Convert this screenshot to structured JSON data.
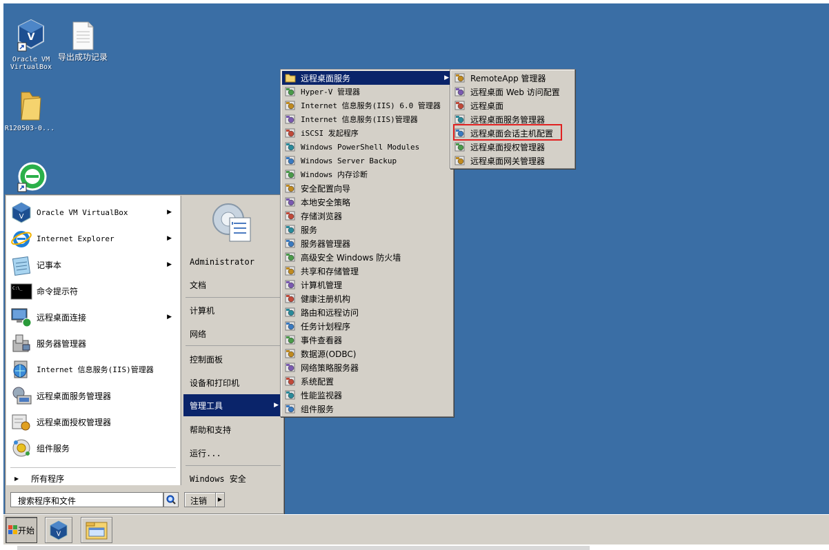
{
  "desktop": {
    "icons": [
      {
        "label": "Oracle VM VirtualBox",
        "label_line1": "Oracle VM",
        "label_line2": "VirtualBox",
        "icon": "virtualbox-icon"
      },
      {
        "label": "导出成功记录",
        "icon": "text-document-icon"
      },
      {
        "label": "R120503-0...",
        "icon": "folder-icon"
      },
      {
        "label": "",
        "icon": "ie-shortcut-icon"
      }
    ]
  },
  "start_menu": {
    "pinned": [
      {
        "label": "Oracle VM VirtualBox",
        "icon": "virtualbox-icon",
        "has_submenu": true,
        "mono": true
      },
      {
        "label": "Internet Explorer",
        "icon": "internet-explorer-icon",
        "has_submenu": true,
        "mono": true
      },
      {
        "label": "记事本",
        "icon": "notepad-icon",
        "has_submenu": true,
        "mono": false
      },
      {
        "label": "命令提示符",
        "icon": "command-prompt-icon",
        "has_submenu": false,
        "mono": false
      },
      {
        "label": "远程桌面连接",
        "icon": "remote-desktop-icon",
        "has_submenu": true,
        "mono": false
      },
      {
        "label": "服务器管理器",
        "icon": "server-manager-icon",
        "has_submenu": false,
        "mono": false
      },
      {
        "label": "Internet 信息服务(IIS)管理器",
        "icon": "iis-manager-icon",
        "has_submenu": false,
        "mono": false
      },
      {
        "label": "远程桌面服务管理器",
        "icon": "rds-manager-icon",
        "has_submenu": false,
        "mono": false
      },
      {
        "label": "远程桌面授权管理器",
        "icon": "rd-licensing-icon",
        "has_submenu": false,
        "mono": false
      },
      {
        "label": "组件服务",
        "icon": "component-services-icon",
        "has_submenu": false,
        "mono": false
      }
    ],
    "all_programs": "所有程序",
    "search_placeholder": "搜索程序和文件",
    "logoff_label": "注销",
    "right_pane": {
      "user": "Administrator",
      "items": [
        {
          "label": "文档"
        },
        {
          "label": "计算机"
        },
        {
          "label": "网络"
        },
        {
          "label": "控制面板"
        },
        {
          "label": "设备和打印机"
        },
        {
          "label": "管理工具",
          "active": true,
          "has_submenu": true
        },
        {
          "label": "帮助和支持"
        },
        {
          "label": "运行..."
        },
        {
          "label": "Windows 安全"
        }
      ]
    }
  },
  "admin_tools_menu": {
    "items": [
      {
        "label": "远程桌面服务",
        "icon": "folder-icon",
        "active": true,
        "has_submenu": true
      },
      {
        "label": "Hyper-V 管理器",
        "icon": "hyperv-icon"
      },
      {
        "label": "Internet 信息服务(IIS) 6.0 管理器",
        "icon": "iis6-icon"
      },
      {
        "label": "Internet 信息服务(IIS)管理器",
        "icon": "iis-manager-icon"
      },
      {
        "label": "iSCSI 发起程序",
        "icon": "iscsi-icon"
      },
      {
        "label": "Windows PowerShell Modules",
        "icon": "powershell-icon"
      },
      {
        "label": "Windows Server Backup",
        "icon": "backup-icon"
      },
      {
        "label": "Windows 内存诊断",
        "icon": "memory-diagnostic-icon"
      },
      {
        "label": "安全配置向导",
        "icon": "security-wizard-icon"
      },
      {
        "label": "本地安全策略",
        "icon": "local-security-policy-icon"
      },
      {
        "label": "存储浏览器",
        "icon": "storage-explorer-icon"
      },
      {
        "label": "服务",
        "icon": "services-icon"
      },
      {
        "label": "服务器管理器",
        "icon": "server-manager-icon"
      },
      {
        "label": "高级安全 Windows 防火墙",
        "icon": "firewall-icon"
      },
      {
        "label": "共享和存储管理",
        "icon": "share-storage-icon"
      },
      {
        "label": "计算机管理",
        "icon": "computer-management-icon"
      },
      {
        "label": "健康注册机构",
        "icon": "health-registration-icon"
      },
      {
        "label": "路由和远程访问",
        "icon": "routing-icon"
      },
      {
        "label": "任务计划程序",
        "icon": "task-scheduler-icon"
      },
      {
        "label": "事件查看器",
        "icon": "event-viewer-icon"
      },
      {
        "label": "数据源(ODBC)",
        "icon": "odbc-icon"
      },
      {
        "label": "网络策略服务器",
        "icon": "nps-icon"
      },
      {
        "label": "系统配置",
        "icon": "system-config-icon"
      },
      {
        "label": "性能监视器",
        "icon": "performance-monitor-icon"
      },
      {
        "label": "组件服务",
        "icon": "component-services-icon"
      }
    ]
  },
  "rds_menu": {
    "items": [
      {
        "label": "RemoteApp 管理器",
        "icon": "remoteapp-icon"
      },
      {
        "label": "远程桌面 Web 访问配置",
        "icon": "rd-web-access-icon"
      },
      {
        "label": "远程桌面",
        "icon": "remote-desktops-icon"
      },
      {
        "label": "远程桌面服务管理器",
        "icon": "rds-manager-icon"
      },
      {
        "label": "远程桌面会话主机配置",
        "icon": "session-host-config-icon",
        "highlighted": true
      },
      {
        "label": "远程桌面授权管理器",
        "icon": "rd-licensing-icon"
      },
      {
        "label": "远程桌面网关管理器",
        "icon": "rd-gateway-icon"
      }
    ]
  },
  "taskbar": {
    "start_label": "开始",
    "buttons": [
      {
        "icon": "virtualbox-icon"
      },
      {
        "icon": "windows-explorer-icon"
      }
    ]
  },
  "colors": {
    "desktop": "#3a6ea5",
    "menu_face": "#d4d0c8",
    "selection": "#0a246a",
    "highlight_box": "#e02020"
  }
}
